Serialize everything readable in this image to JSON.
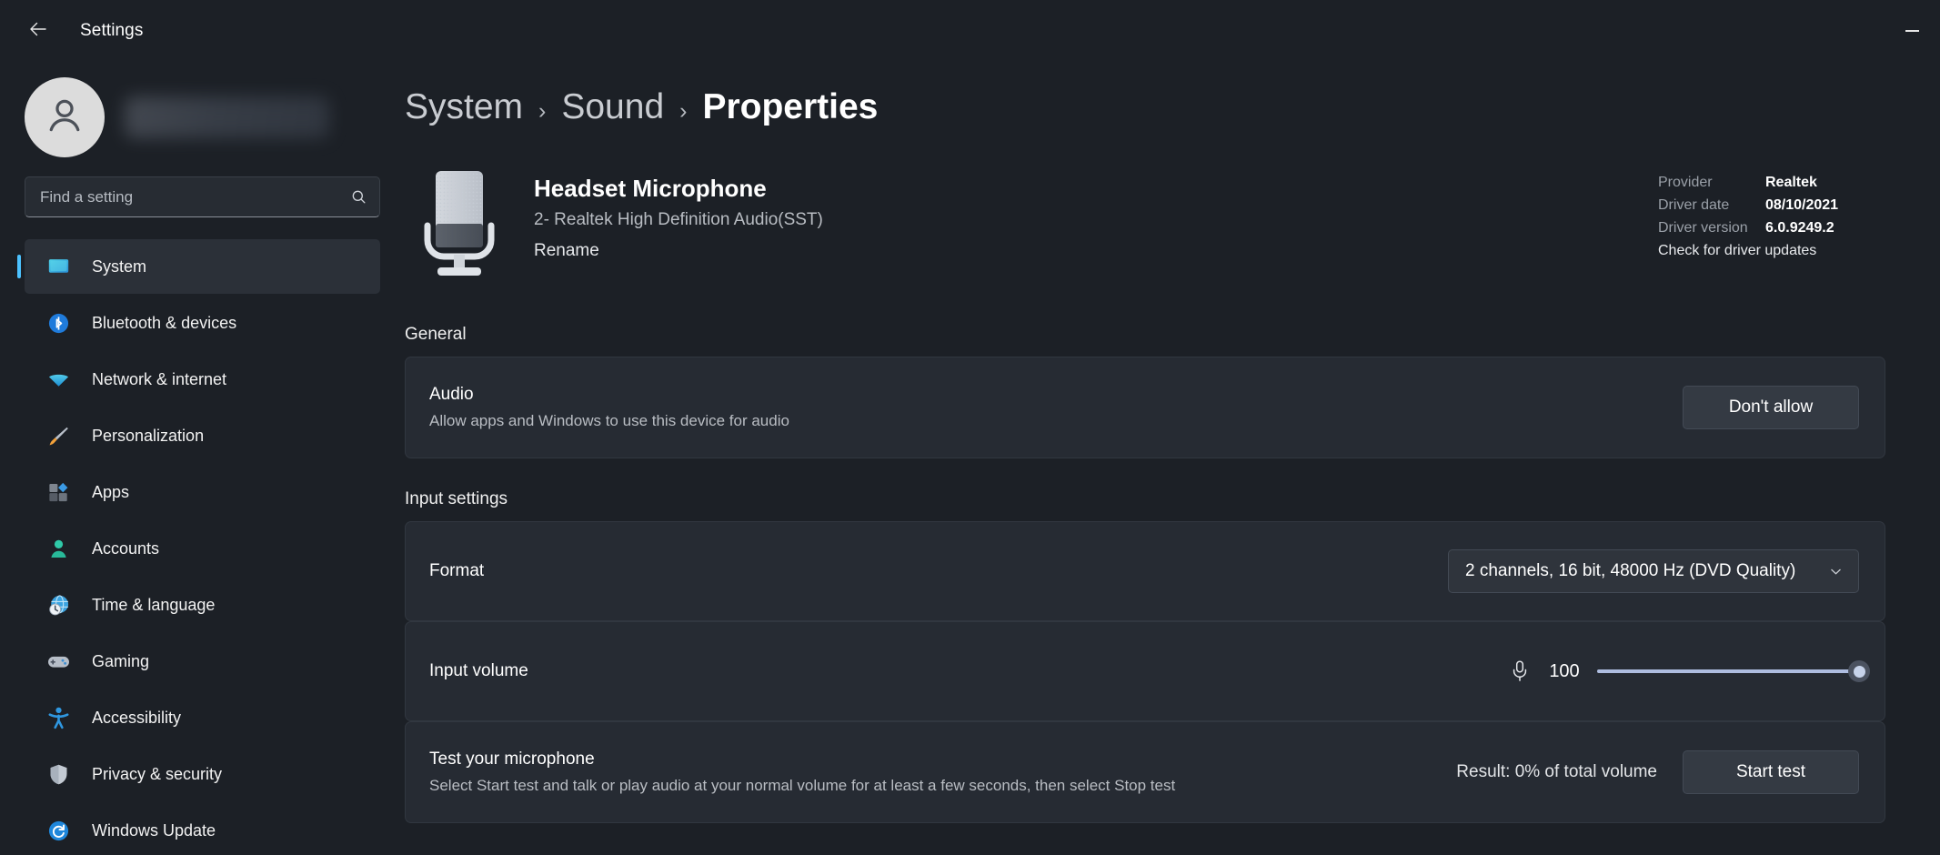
{
  "titlebar": {
    "back_icon": "arrow-left-icon",
    "title": "Settings",
    "minimize_label": "Minimize"
  },
  "sidebar": {
    "account": {
      "avatar_icon": "person-avatar-icon",
      "name_redacted": ""
    },
    "search": {
      "placeholder": "Find a setting",
      "value": "",
      "icon": "search-icon"
    },
    "items": [
      {
        "label": "System",
        "icon": "monitor-icon",
        "selected": true
      },
      {
        "label": "Bluetooth & devices",
        "icon": "bluetooth-icon",
        "selected": false
      },
      {
        "label": "Network & internet",
        "icon": "wifi-icon",
        "selected": false
      },
      {
        "label": "Personalization",
        "icon": "paintbrush-icon",
        "selected": false
      },
      {
        "label": "Apps",
        "icon": "apps-icon",
        "selected": false
      },
      {
        "label": "Accounts",
        "icon": "person-icon",
        "selected": false
      },
      {
        "label": "Time & language",
        "icon": "clock-globe-icon",
        "selected": false
      },
      {
        "label": "Gaming",
        "icon": "gamepad-icon",
        "selected": false
      },
      {
        "label": "Accessibility",
        "icon": "accessibility-icon",
        "selected": false
      },
      {
        "label": "Privacy & security",
        "icon": "shield-icon",
        "selected": false
      },
      {
        "label": "Windows Update",
        "icon": "sync-icon",
        "selected": false
      }
    ]
  },
  "breadcrumb": {
    "items": [
      "System",
      "Sound",
      "Properties"
    ],
    "separator": "›"
  },
  "device": {
    "icon": "microphone-icon",
    "name": "Headset Microphone",
    "subtitle": "2- Realtek High Definition Audio(SST)",
    "rename_label": "Rename",
    "driver": {
      "provider_key": "Provider",
      "provider_value": "Realtek",
      "date_key": "Driver date",
      "date_value": "08/10/2021",
      "version_key": "Driver version",
      "version_value": "6.0.9249.2",
      "check_updates_label": "Check for driver updates"
    }
  },
  "general": {
    "heading": "General",
    "audio": {
      "title": "Audio",
      "subtitle": "Allow apps and Windows to use this device for audio",
      "button_label": "Don't allow"
    }
  },
  "input_settings": {
    "heading": "Input settings",
    "format": {
      "label": "Format",
      "value": "2 channels, 16 bit, 48000 Hz (DVD Quality)",
      "chevron_icon": "chevron-down-icon"
    },
    "input_volume": {
      "label": "Input volume",
      "mic_icon": "microphone-icon",
      "value": "100",
      "min": 0,
      "max": 100,
      "percent": 100
    },
    "test": {
      "title": "Test your microphone",
      "subtitle": "Select Start test and talk or play audio at your normal volume for at least a few seconds, then select Stop test",
      "result": "Result: 0% of total volume",
      "button_label": "Start test"
    }
  },
  "colors": {
    "accent": "#4cc2ff",
    "window_bg": "#1c2026",
    "card_bg": "#262b33",
    "slider_fill": "#aebde0"
  }
}
